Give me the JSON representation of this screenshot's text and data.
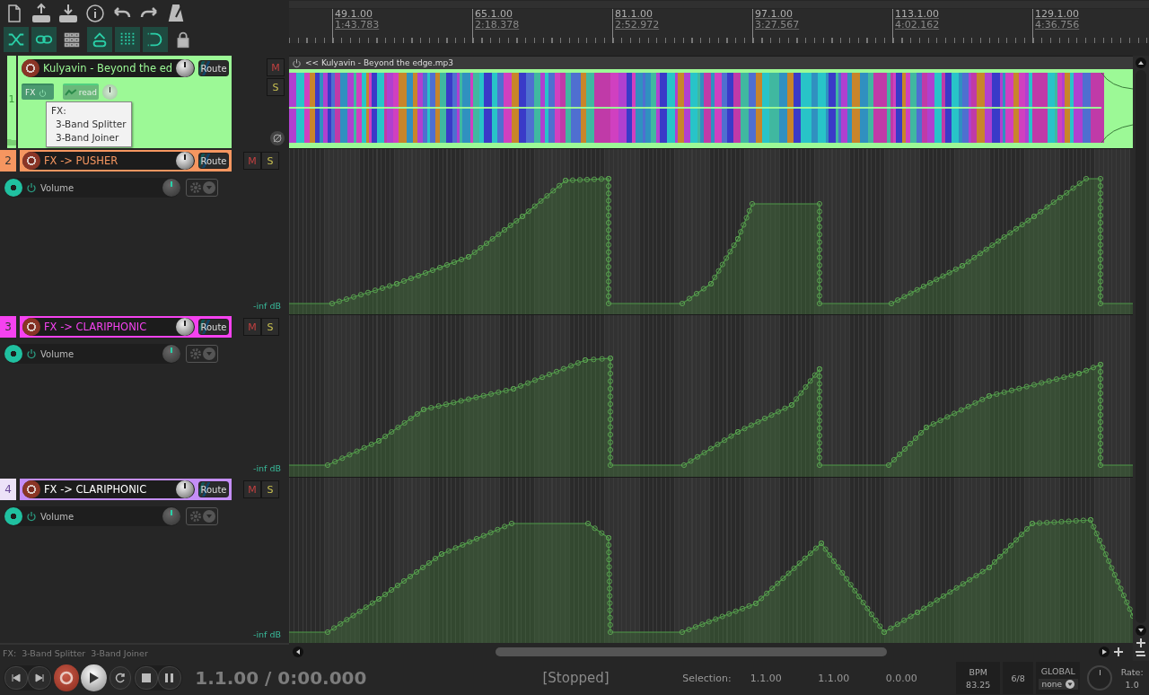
{
  "toolbar": {
    "toggles": [
      {
        "on": true
      },
      {
        "on": true
      },
      {
        "on": false
      },
      {
        "on": true
      },
      {
        "on": true
      },
      {
        "on": true
      },
      {
        "on": false
      }
    ]
  },
  "ruler": {
    "marks": [
      {
        "bar": "49.1.00",
        "time": "1:43.783"
      },
      {
        "bar": "65.1.00",
        "time": "2:18.378"
      },
      {
        "bar": "81.1.00",
        "time": "2:52.972"
      },
      {
        "bar": "97.1.00",
        "time": "3:27.567"
      },
      {
        "bar": "113.1.00",
        "time": "4:02.162"
      },
      {
        "bar": "129.1.00",
        "time": "4:36.756"
      }
    ]
  },
  "tracks": [
    {
      "number": "1",
      "name": "Kulyavin - Beyond the ed",
      "color": "#9cf996",
      "selected": false,
      "kind": "audio",
      "route": "Route",
      "mute": "M",
      "solo": "S",
      "fx": "FX",
      "automation_mode": "read",
      "item": {
        "name": "<< Kulyavin - Beyond the edge.mp3"
      }
    },
    {
      "number": "2",
      "name": "FX -> PUSHER",
      "color": "#f59660",
      "selected": false,
      "kind": "envelope",
      "route": "Route",
      "mute": "M",
      "solo": "S",
      "envelope": {
        "name": "Volume",
        "reading": "-inf dB"
      }
    },
    {
      "number": "3",
      "name": "FX -> CLARIPHONIC",
      "color": "#f542f0",
      "selected": false,
      "kind": "envelope",
      "route": "Route",
      "mute": "M",
      "solo": "S",
      "envelope": {
        "name": "Volume",
        "reading": "-inf dB"
      }
    },
    {
      "number": "4",
      "name": "FX -> CLARIPHONIC",
      "color": "#c48ef7",
      "selected": true,
      "kind": "envelope",
      "route": "Route",
      "mute": "M",
      "solo": "S",
      "envelope": {
        "name": "Volume",
        "reading": "-inf dB"
      }
    }
  ],
  "tooltip": {
    "title": "FX:",
    "lines": [
      "3-Band Splitter",
      "3-Band Joiner"
    ]
  },
  "fx_bar": {
    "label": "FX:",
    "items": [
      "3-Band Splitter",
      "3-Band Joiner"
    ]
  },
  "transport": {
    "position": "1.1.00 / 0:00.000",
    "state": "[Stopped]",
    "selection_label": "Selection:",
    "selection": [
      "1.1.00",
      "1.1.00",
      "0.0.00"
    ],
    "bpm_label": "BPM",
    "bpm": "83.25",
    "time_signature": "6/8",
    "automation_label": "GLOBAL",
    "automation_mode": "none",
    "rate_label": "Rate:",
    "rate": "1.0"
  }
}
